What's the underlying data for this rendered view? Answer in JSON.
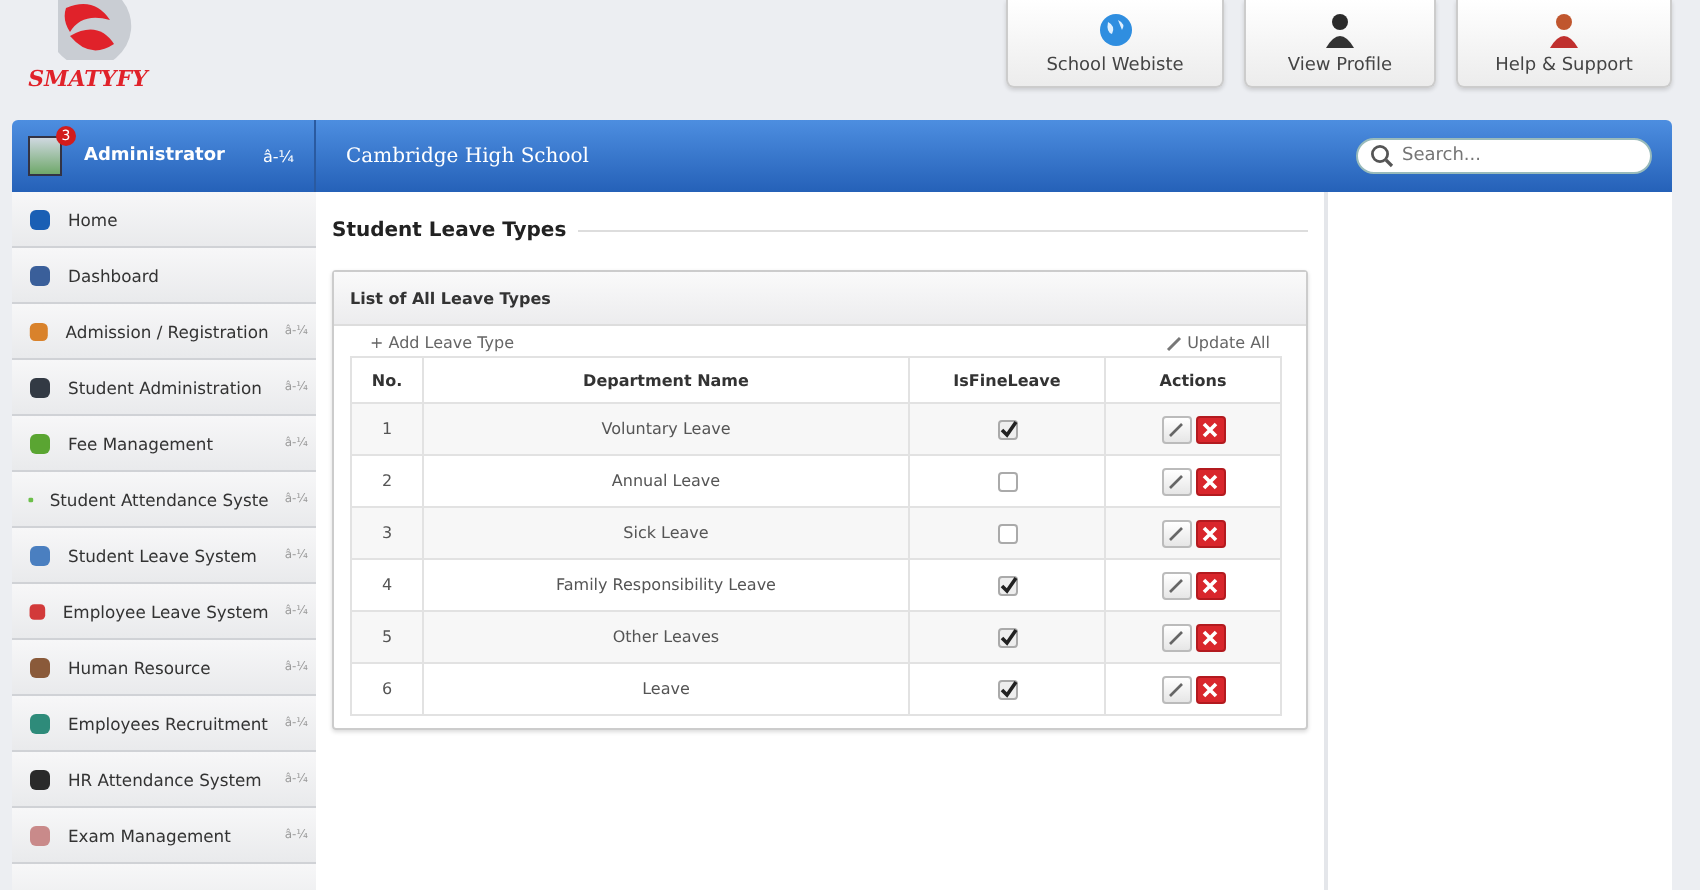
{
  "logo": {
    "text": "SMATYFY"
  },
  "top_buttons": [
    {
      "label": "School Webiste"
    },
    {
      "label": "View Profile"
    },
    {
      "label": "Help & Support"
    }
  ],
  "user": {
    "name": "Administrator",
    "badge": "3",
    "caret": "â-¼"
  },
  "school": "Cambridge High School",
  "search": {
    "placeholder": "Search..."
  },
  "sidebar": {
    "items": [
      {
        "label": "Home"
      },
      {
        "label": "Dashboard"
      },
      {
        "label": "Admission / Registration",
        "caret": "â-¼"
      },
      {
        "label": "Student Administration",
        "caret": "â-¼"
      },
      {
        "label": "Fee Management",
        "caret": "â-¼"
      },
      {
        "label": "Student Attendance Syste",
        "caret": "â-¼"
      },
      {
        "label": "Student Leave System",
        "caret": "â-¼"
      },
      {
        "label": "Employee Leave System",
        "caret": "â-¼"
      },
      {
        "label": "Human Resource",
        "caret": "â-¼"
      },
      {
        "label": "Employees Recruitment",
        "caret": "â-¼"
      },
      {
        "label": "HR Attendance System",
        "caret": "â-¼"
      },
      {
        "label": "Exam Management",
        "caret": "â-¼"
      }
    ]
  },
  "page_title": "Student Leave Types",
  "panel": {
    "title": "List of All Leave Types",
    "add": "+ Add Leave Type",
    "update": "Update All",
    "table": {
      "columns": [
        "No.",
        "Department Name",
        "IsFineLeave",
        "Actions"
      ],
      "rows": [
        {
          "no": "1",
          "name": "Voluntary Leave",
          "checked": true
        },
        {
          "no": "2",
          "name": "Annual Leave",
          "checked": false
        },
        {
          "no": "3",
          "name": "Sick Leave",
          "checked": false
        },
        {
          "no": "4",
          "name": "Family Responsibility Leave",
          "checked": true
        },
        {
          "no": "5",
          "name": "Other Leaves",
          "checked": true
        },
        {
          "no": "6",
          "name": "Leave",
          "checked": true
        }
      ]
    }
  }
}
